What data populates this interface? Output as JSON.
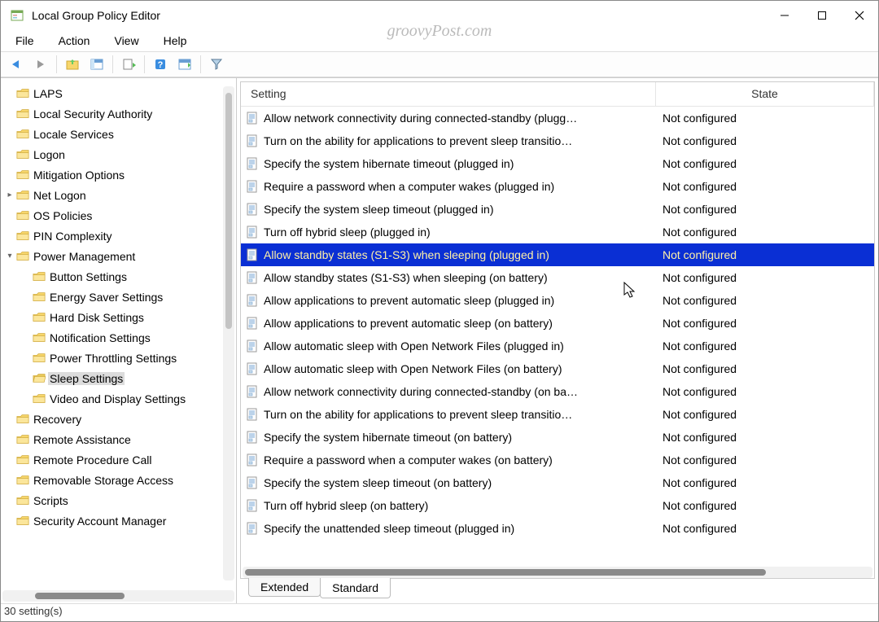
{
  "title": "Local Group Policy Editor",
  "watermark": "groovyPost.com",
  "menu": {
    "file": "File",
    "action": "Action",
    "view": "View",
    "help": "Help"
  },
  "columns": {
    "setting": "Setting",
    "state": "State"
  },
  "tree": [
    {
      "label": "LAPS",
      "depth": 1,
      "expander": ""
    },
    {
      "label": "Local Security Authority",
      "depth": 1,
      "expander": ""
    },
    {
      "label": "Locale Services",
      "depth": 1,
      "expander": ""
    },
    {
      "label": "Logon",
      "depth": 1,
      "expander": ""
    },
    {
      "label": "Mitigation Options",
      "depth": 1,
      "expander": ""
    },
    {
      "label": "Net Logon",
      "depth": 1,
      "expander": "▸"
    },
    {
      "label": "OS Policies",
      "depth": 1,
      "expander": ""
    },
    {
      "label": "PIN Complexity",
      "depth": 1,
      "expander": ""
    },
    {
      "label": "Power Management",
      "depth": 1,
      "expander": "▾"
    },
    {
      "label": "Button Settings",
      "depth": 2,
      "expander": ""
    },
    {
      "label": "Energy Saver Settings",
      "depth": 2,
      "expander": ""
    },
    {
      "label": "Hard Disk Settings",
      "depth": 2,
      "expander": ""
    },
    {
      "label": "Notification Settings",
      "depth": 2,
      "expander": ""
    },
    {
      "label": "Power Throttling Settings",
      "depth": 2,
      "expander": ""
    },
    {
      "label": "Sleep Settings",
      "depth": 2,
      "expander": "",
      "selected": true
    },
    {
      "label": "Video and Display Settings",
      "depth": 2,
      "expander": ""
    },
    {
      "label": "Recovery",
      "depth": 1,
      "expander": ""
    },
    {
      "label": "Remote Assistance",
      "depth": 1,
      "expander": ""
    },
    {
      "label": "Remote Procedure Call",
      "depth": 1,
      "expander": ""
    },
    {
      "label": "Removable Storage Access",
      "depth": 1,
      "expander": ""
    },
    {
      "label": "Scripts",
      "depth": 1,
      "expander": ""
    },
    {
      "label": "Security Account Manager",
      "depth": 1,
      "expander": ""
    }
  ],
  "rows": [
    {
      "name": "Allow network connectivity during connected-standby (plugg…",
      "state": "Not configured"
    },
    {
      "name": "Turn on the ability for applications to prevent sleep transitio…",
      "state": "Not configured"
    },
    {
      "name": "Specify the system hibernate timeout (plugged in)",
      "state": "Not configured"
    },
    {
      "name": "Require a password when a computer wakes (plugged in)",
      "state": "Not configured"
    },
    {
      "name": "Specify the system sleep timeout (plugged in)",
      "state": "Not configured"
    },
    {
      "name": "Turn off hybrid sleep (plugged in)",
      "state": "Not configured"
    },
    {
      "name": "Allow standby states (S1-S3) when sleeping (plugged in)",
      "state": "Not configured",
      "selected": true
    },
    {
      "name": "Allow standby states (S1-S3) when sleeping (on battery)",
      "state": "Not configured"
    },
    {
      "name": "Allow applications to prevent automatic sleep (plugged in)",
      "state": "Not configured"
    },
    {
      "name": "Allow applications to prevent automatic sleep (on battery)",
      "state": "Not configured"
    },
    {
      "name": "Allow automatic sleep with Open Network Files (plugged in)",
      "state": "Not configured"
    },
    {
      "name": "Allow automatic sleep with Open Network Files (on battery)",
      "state": "Not configured"
    },
    {
      "name": "Allow network connectivity during connected-standby (on ba…",
      "state": "Not configured"
    },
    {
      "name": "Turn on the ability for applications to prevent sleep transitio…",
      "state": "Not configured"
    },
    {
      "name": "Specify the system hibernate timeout (on battery)",
      "state": "Not configured"
    },
    {
      "name": "Require a password when a computer wakes (on battery)",
      "state": "Not configured"
    },
    {
      "name": "Specify the system sleep timeout (on battery)",
      "state": "Not configured"
    },
    {
      "name": "Turn off hybrid sleep (on battery)",
      "state": "Not configured"
    },
    {
      "name": "Specify the unattended sleep timeout (plugged in)",
      "state": "Not configured"
    }
  ],
  "tabs": {
    "extended": "Extended",
    "standard": "Standard"
  },
  "status": "30 setting(s)"
}
